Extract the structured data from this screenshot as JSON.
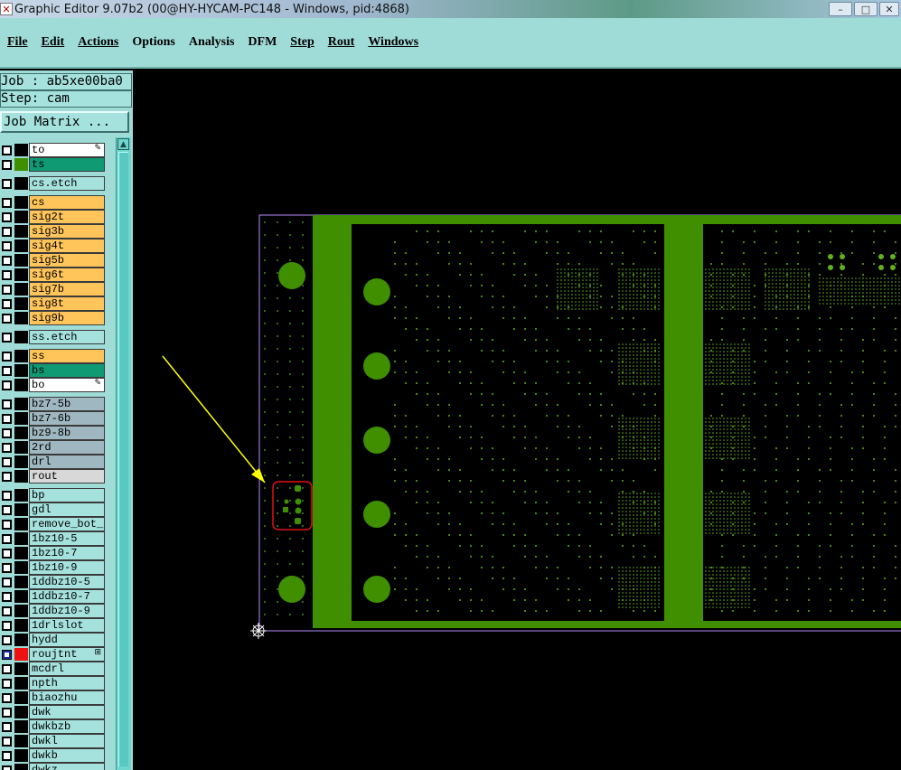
{
  "window": {
    "title": "Graphic Editor 9.07b2 (00@HY-HYCAM-PC148 - Windows, pid:4868)",
    "icon": "x-app-icon"
  },
  "menu": [
    {
      "label": "File"
    },
    {
      "label": "Edit"
    },
    {
      "label": "Actions"
    },
    {
      "label": "Options"
    },
    {
      "label": "Analysis"
    },
    {
      "label": "DFM"
    },
    {
      "label": "Step"
    },
    {
      "label": "Rout"
    },
    {
      "label": "Windows"
    }
  ],
  "panel": {
    "job": "Job : ab5xe00ba0",
    "step": "Step: cam",
    "job_matrix": "Job Matrix ..."
  },
  "layers": [
    {
      "name": "to",
      "bg": "#ffffff",
      "swatch": "#000000",
      "mark": "✎"
    },
    {
      "name": "ts",
      "bg": "#0f9a74",
      "swatch": "#3f8f00",
      "mark": ""
    },
    {
      "name": "cs.etch",
      "bg": "#a5e2de",
      "swatch": "#000000",
      "mark": ""
    },
    {
      "name": "cs",
      "bg": "#ffc55a",
      "swatch": "#000000",
      "mark": ""
    },
    {
      "name": "sig2t",
      "bg": "#ffc55a",
      "swatch": "#000000",
      "mark": ""
    },
    {
      "name": "sig3b",
      "bg": "#ffc55a",
      "swatch": "#000000",
      "mark": ""
    },
    {
      "name": "sig4t",
      "bg": "#ffc55a",
      "swatch": "#000000",
      "mark": ""
    },
    {
      "name": "sig5b",
      "bg": "#ffc55a",
      "swatch": "#000000",
      "mark": ""
    },
    {
      "name": "sig6t",
      "bg": "#ffc55a",
      "swatch": "#000000",
      "mark": ""
    },
    {
      "name": "sig7b",
      "bg": "#ffc55a",
      "swatch": "#000000",
      "mark": ""
    },
    {
      "name": "sig8t",
      "bg": "#ffc55a",
      "swatch": "#000000",
      "mark": ""
    },
    {
      "name": "sig9b",
      "bg": "#ffc55a",
      "swatch": "#000000",
      "mark": ""
    },
    {
      "name": "ss.etch",
      "bg": "#a5e2de",
      "swatch": "#000000",
      "mark": ""
    },
    {
      "name": "ss",
      "bg": "#ffc55a",
      "swatch": "#000000",
      "mark": ""
    },
    {
      "name": "bs",
      "bg": "#0f9a74",
      "swatch": "#000000",
      "mark": ""
    },
    {
      "name": "bo",
      "bg": "#ffffff",
      "swatch": "#000000",
      "mark": "✎"
    },
    {
      "name": "bz7-5b",
      "bg": "#9fb7c0",
      "swatch": "#000000",
      "mark": ""
    },
    {
      "name": "bz7-6b",
      "bg": "#9fb7c0",
      "swatch": "#000000",
      "mark": ""
    },
    {
      "name": "bz9-8b",
      "bg": "#9fb7c0",
      "swatch": "#000000",
      "mark": ""
    },
    {
      "name": "2rd",
      "bg": "#9fb7c0",
      "swatch": "#000000",
      "mark": ""
    },
    {
      "name": "drl",
      "bg": "#9fb7c0",
      "swatch": "#000000",
      "mark": ""
    },
    {
      "name": "rout",
      "bg": "#d8d8d8",
      "swatch": "#000000",
      "mark": ""
    },
    {
      "name": "bp",
      "bg": "#a5e2de",
      "swatch": "#000000",
      "mark": ""
    },
    {
      "name": "gdl",
      "bg": "#a5e2de",
      "swatch": "#000000",
      "mark": ""
    },
    {
      "name": "remove_bot_j",
      "bg": "#a5e2de",
      "swatch": "#000000",
      "mark": ""
    },
    {
      "name": "1bz10-5",
      "bg": "#a5e2de",
      "swatch": "#000000",
      "mark": ""
    },
    {
      "name": "1bz10-7",
      "bg": "#a5e2de",
      "swatch": "#000000",
      "mark": ""
    },
    {
      "name": "1bz10-9",
      "bg": "#a5e2de",
      "swatch": "#000000",
      "mark": ""
    },
    {
      "name": "1ddbz10-5",
      "bg": "#a5e2de",
      "swatch": "#000000",
      "mark": ""
    },
    {
      "name": "1ddbz10-7",
      "bg": "#a5e2de",
      "swatch": "#000000",
      "mark": ""
    },
    {
      "name": "1ddbz10-9",
      "bg": "#a5e2de",
      "swatch": "#000000",
      "mark": ""
    },
    {
      "name": "1drlslot",
      "bg": "#a5e2de",
      "swatch": "#000000",
      "mark": ""
    },
    {
      "name": "hydd",
      "bg": "#a5e2de",
      "swatch": "#000000",
      "mark": ""
    },
    {
      "name": "roujtnt",
      "bg": "#a5e2de",
      "swatch": "#ee1111",
      "mark": "⊞",
      "checked": true
    },
    {
      "name": "mcdrl",
      "bg": "#a5e2de",
      "swatch": "#000000",
      "mark": ""
    },
    {
      "name": "npth",
      "bg": "#a5e2de",
      "swatch": "#000000",
      "mark": ""
    },
    {
      "name": "biaozhu",
      "bg": "#a5e2de",
      "swatch": "#000000",
      "mark": ""
    },
    {
      "name": "dwk",
      "bg": "#a5e2de",
      "swatch": "#000000",
      "mark": ""
    },
    {
      "name": "dwkbzb",
      "bg": "#a5e2de",
      "swatch": "#000000",
      "mark": ""
    },
    {
      "name": "dwkl",
      "bg": "#a5e2de",
      "swatch": "#000000",
      "mark": ""
    },
    {
      "name": "dwkb",
      "bg": "#a5e2de",
      "swatch": "#000000",
      "mark": ""
    },
    {
      "name": "dwkz",
      "bg": "#a5e2de",
      "swatch": "#000000",
      "mark": ""
    }
  ],
  "colors": {
    "copper": "#3f8f00",
    "dots": "#62b01e",
    "outline": "#b98cff",
    "annotation_arrow": "#ffff00",
    "highlight_box": "#e01010"
  }
}
